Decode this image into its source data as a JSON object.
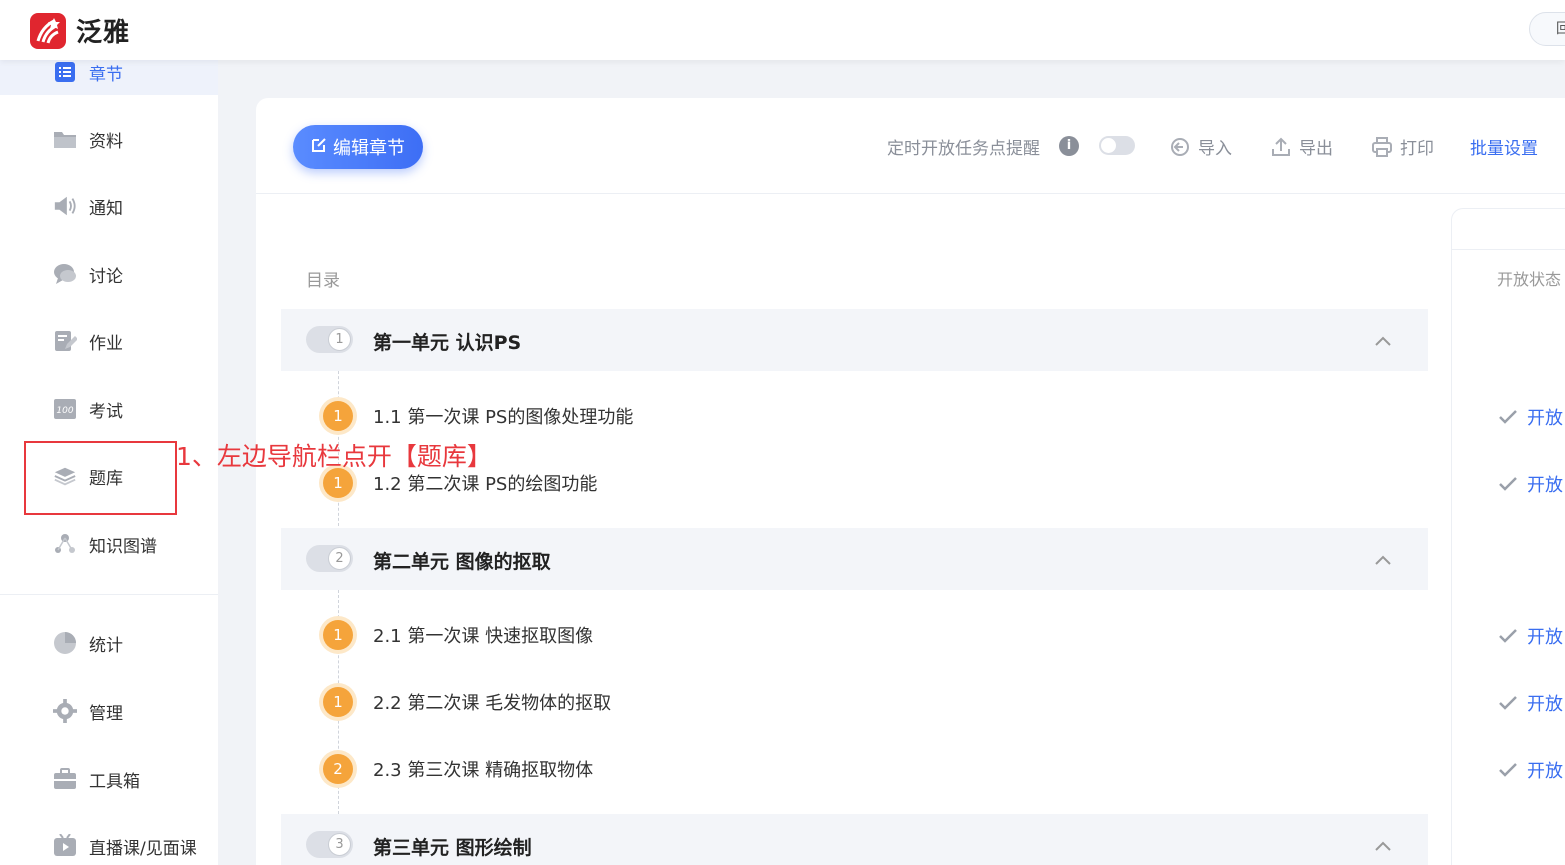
{
  "header": {
    "brand": "泛雅",
    "right_button": "回"
  },
  "sidebar": {
    "items": [
      {
        "label": "章节",
        "icon": "list-icon"
      },
      {
        "label": "资料",
        "icon": "folder-icon"
      },
      {
        "label": "通知",
        "icon": "speaker-icon"
      },
      {
        "label": "讨论",
        "icon": "chat-icon"
      },
      {
        "label": "作业",
        "icon": "pencil-icon"
      },
      {
        "label": "考试",
        "icon": "exam-icon"
      },
      {
        "label": "题库",
        "icon": "layers-icon"
      },
      {
        "label": "知识图谱",
        "icon": "graph-icon"
      },
      {
        "label": "统计",
        "icon": "pie-icon"
      },
      {
        "label": "管理",
        "icon": "gear-icon"
      },
      {
        "label": "工具箱",
        "icon": "toolbox-icon"
      },
      {
        "label": "直播课/见面课",
        "icon": "play-icon"
      }
    ]
  },
  "annotation": {
    "text": "1、左边导航栏点开【题库】"
  },
  "toolbar": {
    "edit_chapter": "编辑章节",
    "timed_reminder": "定时开放任务点提醒",
    "import": "导入",
    "export": "导出",
    "print": "打印",
    "batch_settings": "批量设置"
  },
  "toc": {
    "heading": "目录",
    "status_heading": "开放状态",
    "units": [
      {
        "number": "1",
        "title": "第一单元 认识PS",
        "lessons": [
          {
            "badge": "1",
            "title": "1.1 第一次课 PS的图像处理功能",
            "status": "开放"
          },
          {
            "badge": "1",
            "title": "1.2 第二次课 PS的绘图功能",
            "status": "开放"
          }
        ]
      },
      {
        "number": "2",
        "title": "第二单元 图像的抠取",
        "lessons": [
          {
            "badge": "1",
            "title": "2.1 第一次课 快速抠取图像",
            "status": "开放"
          },
          {
            "badge": "1",
            "title": "2.2 第二次课 毛发物体的抠取",
            "status": "开放"
          },
          {
            "badge": "2",
            "title": "2.3 第三次课 精确抠取物体",
            "status": "开放"
          }
        ]
      },
      {
        "number": "3",
        "title": "第三单元 图形绘制",
        "lessons": []
      }
    ]
  },
  "colors": {
    "accent": "#3a6ef0",
    "badge": "#f5a43b",
    "annotation": "#e8383d",
    "brand": "#e0262f"
  }
}
